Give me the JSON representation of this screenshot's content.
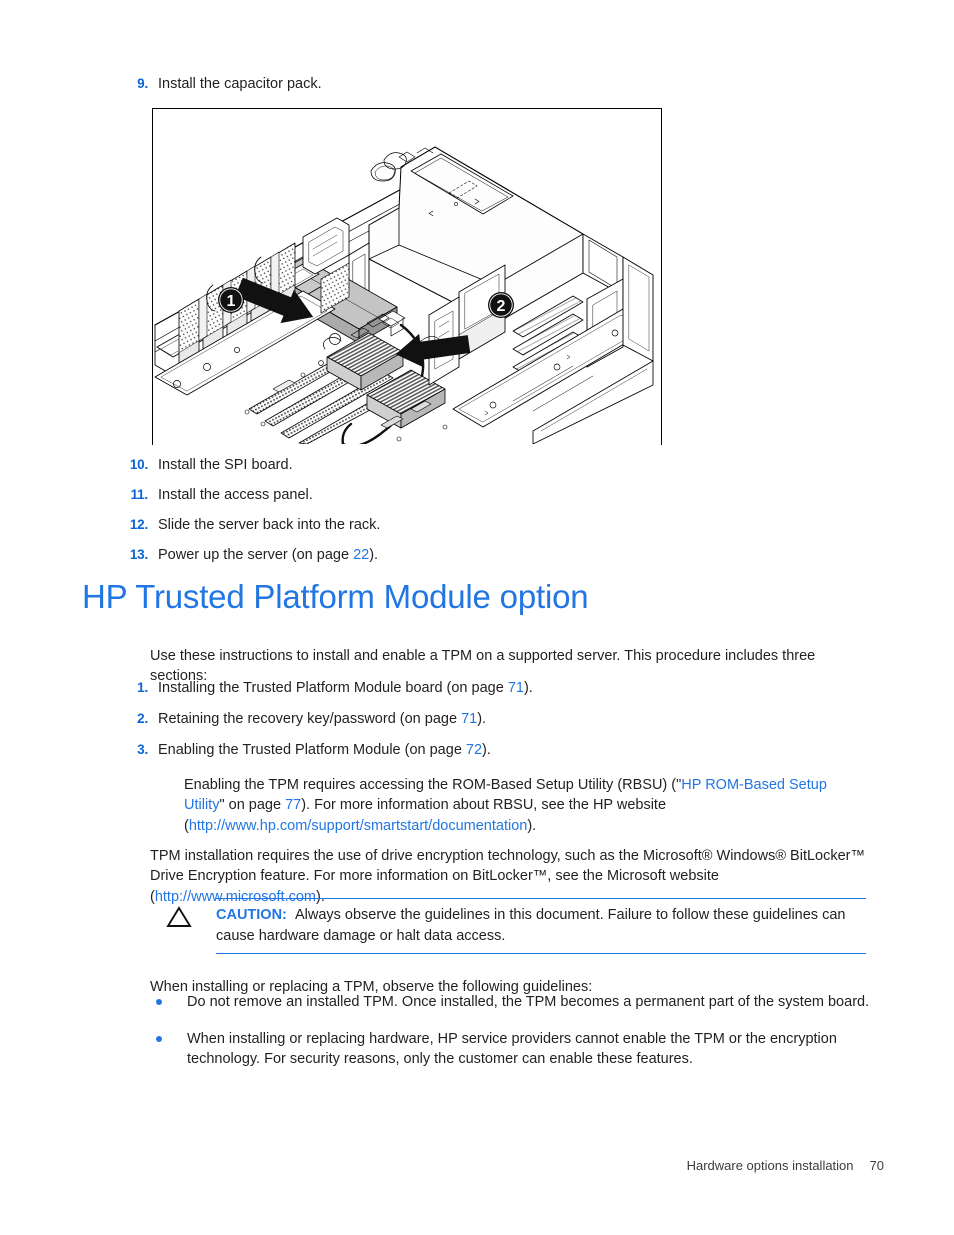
{
  "step_9": {
    "number": "9.",
    "text": "Install the capacitor pack."
  },
  "figure": {
    "caption_callouts": [
      "1",
      "2"
    ],
    "alt": "Exploded line drawing of server chassis interior showing capacitor pack installation with callouts 1 and 2"
  },
  "steps_continued": [
    {
      "number": "10.",
      "text": "Install the SPI board."
    },
    {
      "number": "11.",
      "text": "Install the access panel."
    },
    {
      "number": "12.",
      "text": "Slide the server back into the rack."
    },
    {
      "number": "13.",
      "text": "Power up the server (on page 22)."
    }
  ],
  "step_13_parts": {
    "pre": "Power up the server (on page ",
    "link": "22",
    "post": ")."
  },
  "heading": "HP Trusted Platform Module option",
  "intro_paragraph": "Use these instructions to install and enable a TPM on a supported server. This procedure includes three sections:",
  "tpm_steps": [
    {
      "number": "1.",
      "pre": "Installing the Trusted Platform Module board (on page ",
      "link": "71",
      "post": ")."
    },
    {
      "number": "2.",
      "pre": "Retaining the recovery key/password (on page ",
      "link": "71",
      "post": ")."
    },
    {
      "number": "3.",
      "pre": "Enabling the Trusted Platform Module (on page ",
      "link": "72",
      "post": ")."
    }
  ],
  "rbsu_paragraph": {
    "part1": "Enabling the TPM requires accessing the ROM-Based Setup Utility (RBSU) (\"",
    "link1": "HP ROM-Based Setup Utility",
    "part2": "\" on page ",
    "link2": "77",
    "part3": "). For more information about RBSU, see the HP website (",
    "link3": "http://www.hp.com/support/smartstart/documentation",
    "part4": ")."
  },
  "tpm_install_paragraph": {
    "part1": "TPM installation requires the use of drive encryption technology, such as the Microsoft® Windows® BitLocker™ Drive Encryption feature. For more information on BitLocker™, see the Microsoft website (",
    "link1": "http://www.microsoft.com",
    "part2": ")."
  },
  "caution": {
    "icon": "warning-triangle-icon",
    "label": "CAUTION:",
    "text": "Always observe the guidelines in this document. Failure to follow these guidelines can cause hardware damage or halt data access."
  },
  "guidelines_intro": "When installing or replacing a TPM, observe the following guidelines:",
  "guidelines": [
    "Do not remove an installed TPM. Once installed, the TPM becomes a permanent part of the system board.",
    "When installing or replacing hardware, HP service providers cannot enable the TPM or the encryption technology. For security reasons, only the customer can enable these features."
  ],
  "footer": {
    "section": "Hardware options installation",
    "page_number": "70"
  },
  "colors": {
    "link": "#2276e3",
    "heading": "#2276e3",
    "body": "#231f20",
    "number": "#0a64d2"
  }
}
